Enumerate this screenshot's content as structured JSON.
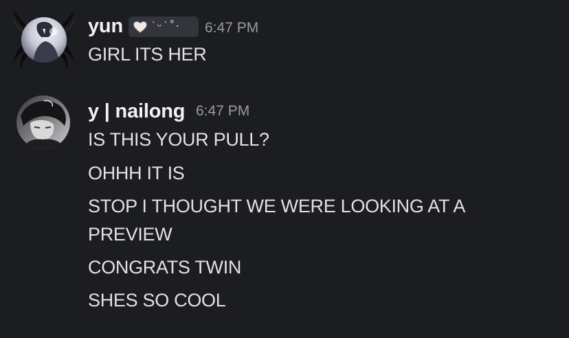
{
  "messages": [
    {
      "author": "yun",
      "tag": "˙ᵕ˙˚·",
      "timestamp": "6:47 PM",
      "lines": [
        "GIRL ITS HER"
      ]
    },
    {
      "author": "y | nailong",
      "timestamp": "6:47 PM",
      "lines": [
        "IS THIS YOUR PULL?",
        "OHHH IT IS",
        "STOP I THOUGHT WE WERE LOOKING AT A",
        "PREVIEW",
        "CONGRATS TWIN",
        "SHES SO COOL"
      ]
    }
  ],
  "colors": {
    "background": "#1c1d21",
    "username": "#f2f2f4",
    "timestamp": "#9a9ba3",
    "message_text": "#e3e3e6",
    "tag_background": "#33343c"
  },
  "icons": {
    "avatar_1": "winged-anime-avatar",
    "avatar_2": "monochrome-anime-avatar",
    "tag_icon": "heart-icon"
  }
}
